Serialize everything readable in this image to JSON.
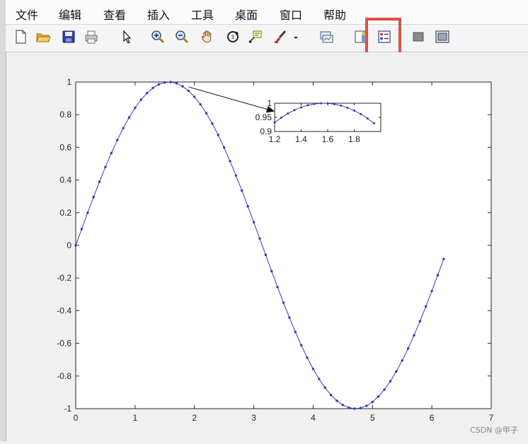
{
  "menubar": {
    "items": [
      {
        "label": "文件",
        "name": "menu-file"
      },
      {
        "label": "编辑",
        "name": "menu-edit"
      },
      {
        "label": "查看",
        "name": "menu-view"
      },
      {
        "label": "插入",
        "name": "menu-insert"
      },
      {
        "label": "工具",
        "name": "menu-tools"
      },
      {
        "label": "桌面",
        "name": "menu-desktop"
      },
      {
        "label": "窗口",
        "name": "menu-window"
      },
      {
        "label": "帮助",
        "name": "menu-help"
      }
    ]
  },
  "toolbar": {
    "buttons": [
      {
        "icon": "new-figure-icon"
      },
      {
        "icon": "open-file-icon"
      },
      {
        "icon": "save-figure-icon"
      },
      {
        "icon": "print-figure-icon"
      },
      {
        "icon": "edit-plot-arrow-icon"
      },
      {
        "icon": "zoom-in-icon"
      },
      {
        "icon": "zoom-out-icon"
      },
      {
        "icon": "pan-hand-icon"
      },
      {
        "icon": "rotate-3d-icon"
      },
      {
        "icon": "data-cursor-icon"
      },
      {
        "icon": "brush-icon"
      },
      {
        "icon": "brush-dropdown-icon"
      },
      {
        "icon": "link-plot-icon"
      },
      {
        "icon": "insert-colorbar-icon"
      },
      {
        "icon": "insert-legend-icon"
      },
      {
        "icon": "hide-plot-tools-icon"
      },
      {
        "icon": "show-plot-tools-icon"
      }
    ],
    "highlight_color": "#d75345"
  },
  "chart_data": [
    {
      "type": "line",
      "title": "",
      "xlabel": "",
      "ylabel": "",
      "xlim": [
        0,
        7
      ],
      "ylim": [
        -1,
        1
      ],
      "x_ticks": [
        "0",
        "1",
        "2",
        "3",
        "4",
        "5",
        "6",
        "7"
      ],
      "y_ticks": [
        "-1",
        "-0.8",
        "-0.6",
        "-0.4",
        "-0.2",
        "0",
        "0.2",
        "0.4",
        "0.6",
        "0.8",
        "1"
      ],
      "series": [
        {
          "function": "sin(x)",
          "x_start": 0,
          "x_end": 6.2,
          "x_step": 0.1,
          "marker": ".",
          "color": "#3636b0"
        }
      ],
      "grid": false,
      "background": "#ffffff",
      "annotation": {
        "type": "arrow",
        "from": [
          1.9,
          0.97
        ],
        "to": [
          3.35,
          0.82
        ],
        "color": "#111111"
      }
    },
    {
      "type": "line",
      "title": "",
      "xlim": [
        1.2,
        2
      ],
      "ylim": [
        0.9,
        1
      ],
      "x_ticks": [
        "1.2",
        "1.4",
        "1.6",
        "1.8"
      ],
      "y_ticks": [
        "0.9",
        "0.95",
        "1"
      ],
      "series": [
        {
          "function": "sin(x)",
          "x_start": 1.2,
          "x_end": 1.95,
          "x_step": 0.05,
          "marker": ".",
          "color": "#3636b0"
        }
      ],
      "grid": false,
      "background": "#ffffff"
    }
  ],
  "watermark": {
    "text": "CSDN @甲子"
  }
}
